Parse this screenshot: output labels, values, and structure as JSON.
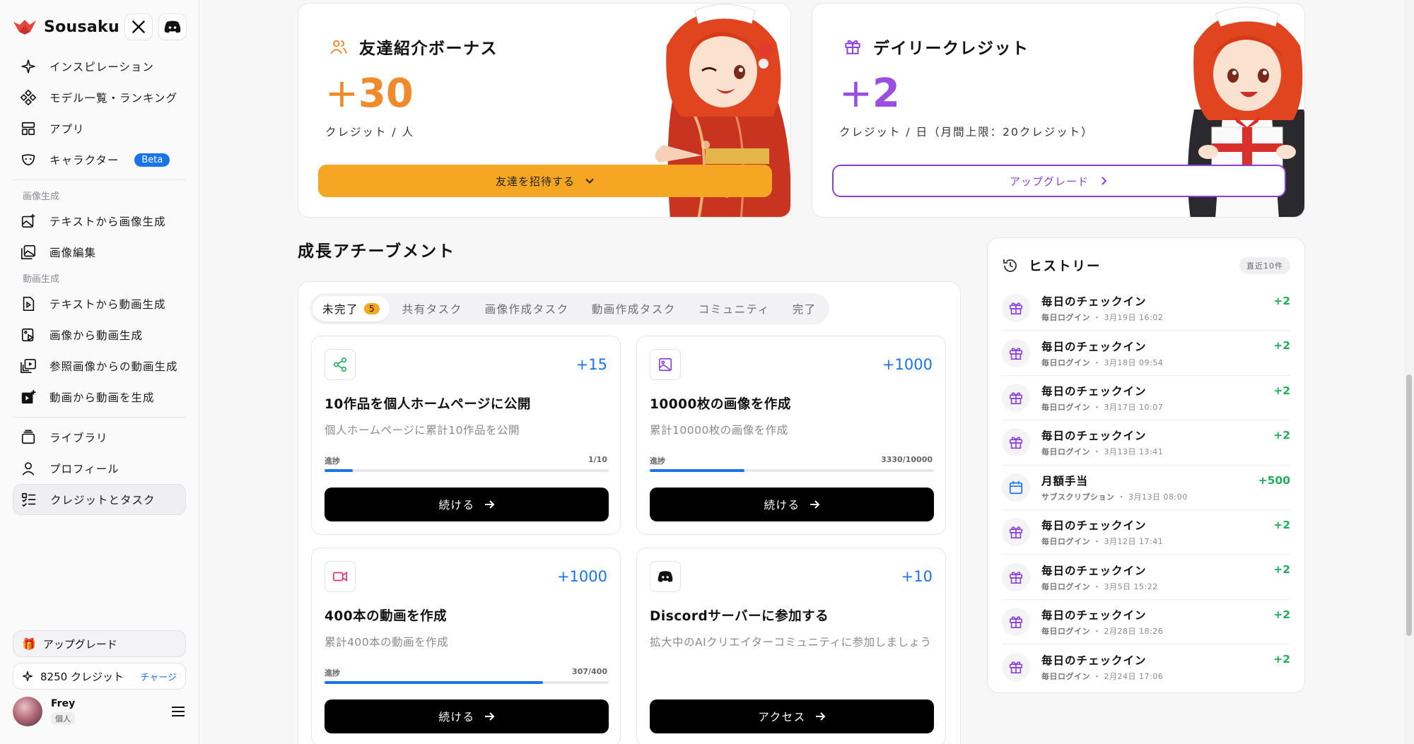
{
  "brand": {
    "name": "Sousaku"
  },
  "sidebar": {
    "items": [
      {
        "label": "インスピレーション"
      },
      {
        "label": "モデル一覧・ランキング"
      },
      {
        "label": "アプリ"
      },
      {
        "label": "キャラクター",
        "badge": "Beta"
      }
    ],
    "section_image": "画像生成",
    "image_items": [
      {
        "label": "テキストから画像生成"
      },
      {
        "label": "画像編集"
      }
    ],
    "section_video": "動画生成",
    "video_items": [
      {
        "label": "テキストから動画生成"
      },
      {
        "label": "画像から動画生成"
      },
      {
        "label": "参照画像からの動画生成"
      },
      {
        "label": "動画から動画を生成"
      }
    ],
    "bottom_items": [
      {
        "label": "ライブラリ"
      },
      {
        "label": "プロフィール"
      },
      {
        "label": "クレジットとタスク"
      }
    ],
    "upgrade_label": "アップグレード",
    "credits_label": "8250 クレジット",
    "charge_label": "チャージ",
    "user": {
      "name": "Frey",
      "tag": "個人"
    }
  },
  "referral": {
    "title": "友達紹介ボーナス",
    "sign": "+",
    "amount": "30",
    "unit": "クレジット / 人",
    "button": "友達を招待する"
  },
  "daily": {
    "title": "デイリークレジット",
    "sign": "+",
    "amount": "2",
    "unit": "クレジット / 日（月間上限：20クレジット）",
    "button": "アップグレード"
  },
  "achievements": {
    "title": "成長アチーブメント",
    "tabs": [
      {
        "label": "未完了",
        "count": "5"
      },
      {
        "label": "共有タスク"
      },
      {
        "label": "画像作成タスク"
      },
      {
        "label": "動画作成タスク"
      },
      {
        "label": "コミュニティ"
      },
      {
        "label": "完了"
      }
    ],
    "progress_label": "進捗",
    "tasks": [
      {
        "points": "+15",
        "title": "10作品を個人ホームページに公開",
        "desc": "個人ホームページに累計10作品を公開",
        "progress": "1/10",
        "progress_fraction": 0.1,
        "button": "続ける"
      },
      {
        "points": "+1000",
        "title": "10000枚の画像を作成",
        "desc": "累計10000枚の画像を作成",
        "progress": "3330/10000",
        "progress_fraction": 0.333,
        "button": "続ける"
      },
      {
        "points": "+1000",
        "title": "400本の動画を作成",
        "desc": "累計400本の動画を作成",
        "progress": "307/400",
        "progress_fraction": 0.7675,
        "button": "続ける"
      },
      {
        "points": "+10",
        "title": "Discordサーバーに参加する",
        "desc": "拡大中のAIクリエイターコミュニティに参加しましょう",
        "button": "アクセス"
      }
    ]
  },
  "history": {
    "title": "ヒストリー",
    "badge": "直近10件",
    "rows": [
      {
        "name": "毎日のチェックイン",
        "source": "毎日ログイン",
        "date": "3月19日 16:02",
        "amount": "+2",
        "icon": "gift-icon"
      },
      {
        "name": "毎日のチェックイン",
        "source": "毎日ログイン",
        "date": "3月18日 09:54",
        "amount": "+2",
        "icon": "gift-icon"
      },
      {
        "name": "毎日のチェックイン",
        "source": "毎日ログイン",
        "date": "3月17日 10:07",
        "amount": "+2",
        "icon": "gift-icon"
      },
      {
        "name": "毎日のチェックイン",
        "source": "毎日ログイン",
        "date": "3月13日 13:41",
        "amount": "+2",
        "icon": "gift-icon"
      },
      {
        "name": "月額手当",
        "source": "サブスクリプション",
        "date": "3月13日 08:00",
        "amount": "+500",
        "icon": "calendar-icon"
      },
      {
        "name": "毎日のチェックイン",
        "source": "毎日ログイン",
        "date": "3月12日 17:41",
        "amount": "+2",
        "icon": "gift-icon"
      },
      {
        "name": "毎日のチェックイン",
        "source": "毎日ログイン",
        "date": "3月5日 15:22",
        "amount": "+2",
        "icon": "gift-icon"
      },
      {
        "name": "毎日のチェックイン",
        "source": "毎日ログイン",
        "date": "2月28日 18:26",
        "amount": "+2",
        "icon": "gift-icon"
      },
      {
        "name": "毎日のチェックイン",
        "source": "毎日ログイン",
        "date": "2月24日 17:06",
        "amount": "+2",
        "icon": "gift-icon"
      }
    ]
  },
  "colors": {
    "orange": "#f5a623",
    "purple": "#8b3fd9",
    "blue": "#1a73e8",
    "green": "#1fae5a"
  }
}
